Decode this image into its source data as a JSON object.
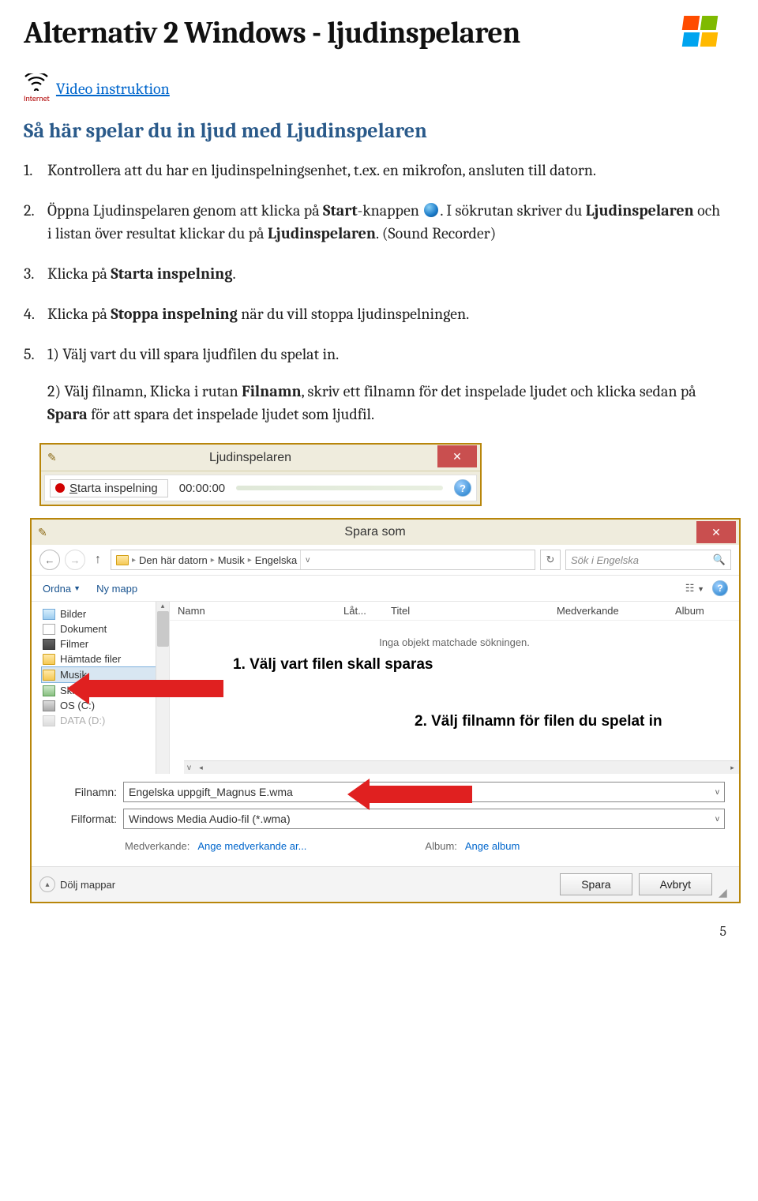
{
  "header": {
    "title": "Alternativ 2 Windows - ljudinspelaren"
  },
  "link_block": {
    "label": "Internet",
    "link_text": "Video instruktion"
  },
  "subtitle": "Så här spelar du in ljud med Ljudinspelaren",
  "steps": {
    "s1": {
      "num": "1.",
      "text": "Kontrollera att du har en ljudinspelningsenhet, t.ex. en mikrofon, ansluten till datorn."
    },
    "s2": {
      "num": "2.",
      "pre": "Öppna Ljudinspelaren genom att klicka på ",
      "start_bold": "Start",
      "post_start": "-knappen ",
      "post_orb": ". I sökrutan skriver du ",
      "lj1": "Ljudinspelaren",
      "mid": " och i listan över resultat klickar du på ",
      "lj2": "Ljudinspelaren",
      "end": ". (Sound Recorder)"
    },
    "s3": {
      "num": "3.",
      "pre": "Klicka på ",
      "bold": "Starta inspelning",
      "post": "."
    },
    "s4": {
      "num": "4.",
      "pre": "Klicka på ",
      "bold": "Stoppa inspelning",
      "post": " när du vill stoppa ljudinspelningen."
    },
    "s5": {
      "num": "5.",
      "p1": "1) Välj vart du vill spara ljudfilen du spelat in.",
      "p2_a": "2) Välj filnamn, Klicka i rutan ",
      "p2_b": "Filnamn",
      "p2_c": ", skriv ett filnamn för det inspelade ljudet och klicka sedan på ",
      "p2_d": "Spara",
      "p2_e": " för att spara det inspelade ljudet som ljudfil."
    }
  },
  "recorder": {
    "title": "Ljudinspelaren",
    "button_label": "Starta inspelning",
    "button_underline_char": "S",
    "time": "00:00:00",
    "help": "?"
  },
  "saveas": {
    "title": "Spara som",
    "breadcrumb": [
      "Den här datorn",
      "Musik",
      "Engelska"
    ],
    "search_placeholder": "Sök i Engelska",
    "toolbar": {
      "organize": "Ordna",
      "newfolder": "Ny mapp"
    },
    "tree": [
      "Bilder",
      "Dokument",
      "Filmer",
      "Hämtade filer",
      "Musik",
      "Skrivbord",
      "OS (C:)",
      "DATA (D:)"
    ],
    "selected_tree": "Musik",
    "columns": [
      "Namn",
      "Låt...",
      "Titel",
      "Medverkande",
      "Album"
    ],
    "empty": "Inga objekt matchade sökningen.",
    "annot1": "1. Välj vart filen skall sparas",
    "annot2": "2. Välj filnamn för filen du spelat in",
    "fields": {
      "filename_label": "Filnamn:",
      "filename_value": "Engelska uppgift_Magnus E.wma",
      "format_label": "Filformat:",
      "format_value": "Windows Media Audio-fil (*.wma)",
      "contrib_label": "Medverkande:",
      "contrib_value": "Ange medverkande ar...",
      "album_label": "Album:",
      "album_value": "Ange album"
    },
    "footer": {
      "hide": "Dölj mappar",
      "save": "Spara",
      "cancel": "Avbryt"
    }
  },
  "page_number": "5"
}
